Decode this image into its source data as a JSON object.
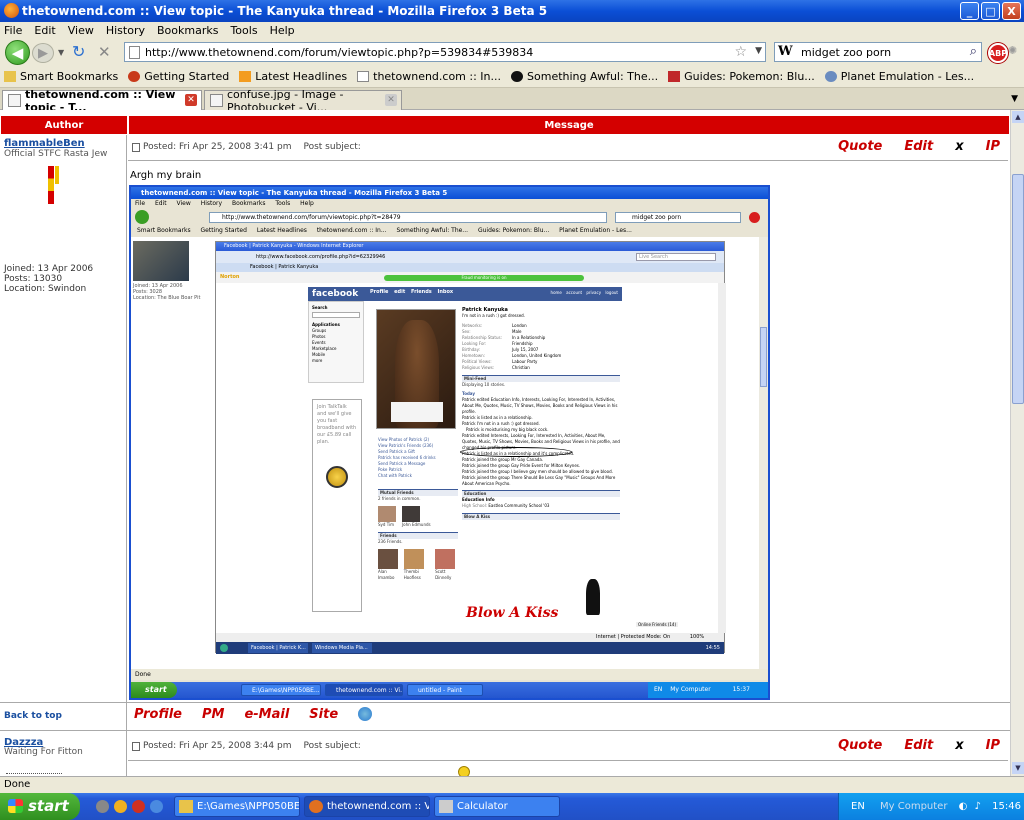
{
  "window": {
    "title": "thetownend.com :: View topic - The Kanyuka thread - Mozilla Firefox 3 Beta 5",
    "min": "_",
    "max": "□",
    "close": "X"
  },
  "menu": [
    "File",
    "Edit",
    "View",
    "History",
    "Bookmarks",
    "Tools",
    "Help"
  ],
  "nav": {
    "url": "http://www.thetownend.com/forum/viewtopic.php?p=539834#539834",
    "search_value": "midget zoo porn",
    "search_engine_icon": "W",
    "abp": "ABP"
  },
  "bookmarks": [
    "Smart Bookmarks",
    "Getting Started",
    "Latest Headlines",
    "thetownend.com :: In...",
    "Something Awful: The...",
    "Guides: Pokemon: Blu...",
    "Planet Emulation - Les..."
  ],
  "tabs": [
    {
      "label": "thetownend.com :: View topic - T..."
    },
    {
      "label": "confuse.jpg - Image - Photobucket - Vi..."
    }
  ],
  "table_headers": {
    "author": "Author",
    "message": "Message"
  },
  "post1": {
    "username": "flammableBen",
    "rank": "Official STFC Rasta Jew",
    "joined": "Joined: 13 Apr 2006",
    "posts": "Posts: 13030",
    "location": "Location: Swindon",
    "posted": "Posted: Fri Apr 25, 2008 3:41 pm",
    "subject": "Post subject:",
    "message": "Argh my brain"
  },
  "post_buttons": {
    "quote": "Quote",
    "edit": "Edit",
    "delete": "x",
    "ip": "IP"
  },
  "inner_screenshot": {
    "title": "thetownend.com :: View topic - The Kanyuka thread - Mozilla Firefox 3 Beta 5",
    "menu": [
      "File",
      "Edit",
      "View",
      "History",
      "Bookmarks",
      "Tools",
      "Help"
    ],
    "url": "http://www.thetownend.com/forum/viewtopic.php?t=28479",
    "search": "midget zoo porn",
    "bookmarks": [
      "Smart Bookmarks",
      "Getting Started",
      "Latest Headlines",
      "thetownend.com :: In...",
      "Something Awful: The...",
      "Guides: Pokemon: Blu...",
      "Planet Emulation - Les..."
    ],
    "left_user": {
      "joined": "Joined: 13 Apr 2006",
      "posts": "Posts: 3028",
      "location": "Location: The Blue Boar Pit"
    },
    "ie_title": "Facebook | Patrick Kanyuka - Windows Internet Explorer",
    "ie_url": "http://www.facebook.com/profile.php?id=62329946",
    "ie_search": "Live Search",
    "ie_tab": "Facebook | Patrick Kanyuka",
    "norton": "Norton",
    "norton_bar": "Fraud monitoring is on",
    "fb": {
      "logo": "facebook",
      "nav": [
        "Profile",
        "edit",
        "Friends",
        "Inbox"
      ],
      "nav_right": [
        "home",
        "account",
        "privacy",
        "logout"
      ],
      "search": "Search",
      "applications": "Applications",
      "apps": [
        "Groups",
        "Photos",
        "Events",
        "Marketplace",
        "Mobile",
        "more"
      ],
      "ad": "Join TalkTalk and we'll give you fast broadband with our £5.89 call plan.",
      "name": "Patrick Kanyuka",
      "status": "I'm not in a rush :) got dressed.",
      "details": [
        [
          "Networks:",
          "London"
        ],
        [
          "Sex:",
          "Male"
        ],
        [
          "Relationship Status:",
          "In a Relationship"
        ],
        [
          "Looking For:",
          "Friendship"
        ],
        [
          "Birthday:",
          "July 15, 2007"
        ],
        [
          "Hometown:",
          "London, United Kingdom"
        ],
        [
          "Political Views:",
          "Labour Party"
        ],
        [
          "Religious Views:",
          "Christian"
        ]
      ],
      "links": [
        "View Photos of Patrick (2)",
        "View Patrick's Friends (236)",
        "Send Patrick a Gift",
        "Patrick has received 6 drinks",
        "Send Patrick a Message",
        "Poke Patrick",
        "Chat with Patrick"
      ],
      "minifeed": "Mini-Feed",
      "feed_sub": "Displaying 10 stories.",
      "today": "Today",
      "feed": [
        "Patrick edited Education Info, Interests, Looking For, Interested In, Activities, About Me, Quotes, Music, TV Shows, Movies, Books and Religious Views in his profile.",
        "Patrick is listed as in a relationship.",
        "Patrick I'm not in a rush :) got dressed.",
        "Patrick is moisturising my big black cock.",
        "Patrick edited Interests, Looking For, Interested In, Activities, About Me, Quotes, Music, TV Shows, Movies, Books and Religious Views in his profile, and changed his profile picture.",
        "Patrick is listed as in a relationship and it's complicated.",
        "Patrick joined the group Mr Gay Canada.",
        "Patrick joined the group Gay Pride Event for Milton Keynes.",
        "Patrick joined the group I believe gay men should be allowed to give blood.",
        "Patrick joined the group There Should Be Less Gay \"Music\" Groups And More About American Psycho."
      ],
      "mutual": "Mutual Friends",
      "mutual_sub": "2 friends in common.",
      "mutual_names": [
        "Syd Tim",
        "John Edmunds"
      ],
      "friends": "Friends",
      "friends_sub": "236 Friends.",
      "friend_names": [
        "Alan Imambo",
        "Thembi Hoofless",
        "Scott Dinnelly"
      ],
      "see_all": "See All",
      "education": "Education",
      "education_info": "Education Info",
      "high_school": "High School:",
      "school": "Eastlea Community School '03",
      "blow_a_kiss_header": "Blow A Kiss",
      "blow_a_kiss": "Blow A Kiss",
      "online_friends": "Online Friends (14)",
      "ie_status": "Internet | Protected Mode: On",
      "ie_zoom": "100%",
      "ie_task": [
        "Facebook | Patrick K...",
        "Windows Media Pla..."
      ],
      "ie_clock": "14:55"
    },
    "done": "Done",
    "taskbar": {
      "start": "start",
      "items": [
        "E:\\Games\\NPP050BE...",
        "thetownend.com :: Vi...",
        "untitled - Paint"
      ],
      "lang": "EN",
      "mycomputer": "My Computer",
      "clock": "15:37"
    }
  },
  "back_to_top": "Back to top",
  "profile_buttons": {
    "profile": "Profile",
    "pm": "PM",
    "email": "e-Mail",
    "site": "Site"
  },
  "post2": {
    "username": "Dazzza",
    "rank": "Waiting For Fitton",
    "posted": "Posted: Fri Apr 25, 2008 3:44 pm",
    "subject": "Post subject:"
  },
  "statusbar": "Done",
  "taskbar": {
    "start": "start",
    "items": [
      "E:\\Games\\NPP050BE...",
      "thetownend.com :: Vi...",
      "Calculator"
    ],
    "lang": "EN",
    "mycomputer": "My Computer",
    "clock": "15:46"
  }
}
